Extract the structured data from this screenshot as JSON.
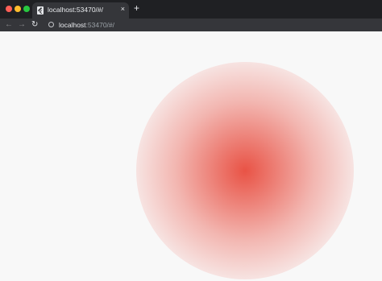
{
  "browser": {
    "tab": {
      "title": "localhost:53470/#/",
      "close_glyph": "×"
    },
    "new_tab_glyph": "+",
    "nav": {
      "back_glyph": "←",
      "forward_glyph": "→",
      "reload_glyph": "↻"
    },
    "address": {
      "host": "localhost",
      "rest": ":53470/#/"
    }
  },
  "page": {
    "visual": "radial-gradient-circle",
    "accent_color": "#e84a3c"
  }
}
